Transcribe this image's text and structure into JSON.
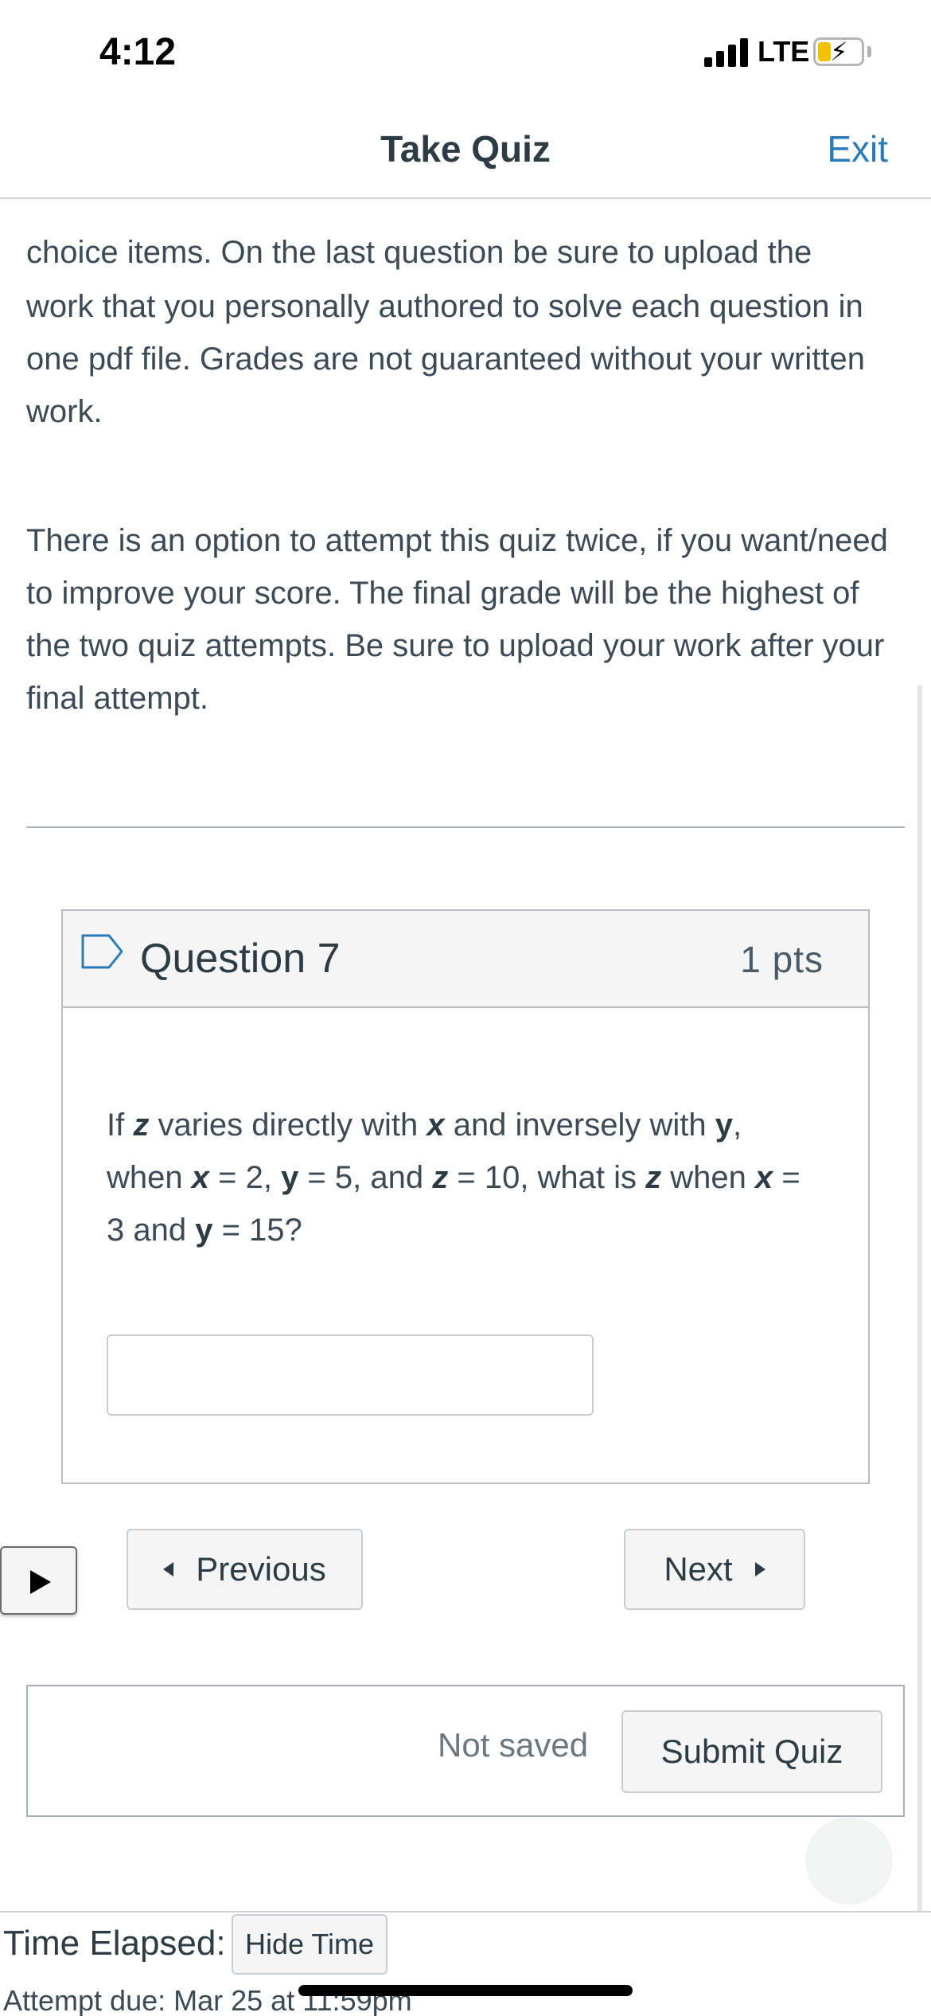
{
  "status_bar": {
    "time": "4:12",
    "network": "LTE",
    "icons": [
      "signal-icon",
      "battery-charging-icon"
    ]
  },
  "nav": {
    "title": "Take Quiz",
    "exit_label": "Exit",
    "exit_color": "#2b7abc"
  },
  "instructions": {
    "partial_line": "choice items.  On the last question be sure to upload the",
    "paragraph_1": "work that you personally authored to solve each question in one pdf file.  Grades are not guaranteed without your written work.",
    "paragraph_2": "There is an option to attempt this quiz twice, if you want/need to improve your score.  The final grade will be the highest of the two quiz attempts.  Be sure to upload your work after your final attempt."
  },
  "question": {
    "title": "Question 7",
    "points": "1 pts",
    "text_parts": [
      "If ",
      "z",
      " varies directly with ",
      "x",
      " and inversely with ",
      "y",
      ",",
      " when ",
      "x",
      " = 2, ",
      "y",
      " = 5, and ",
      "z",
      " = 10, what is ",
      "z",
      " when ",
      "x",
      " = 3 and ",
      "y",
      " = 15?"
    ],
    "answer_value": "",
    "answer_placeholder": ""
  },
  "navigation": {
    "previous_label": "Previous",
    "next_label": "Next"
  },
  "submit": {
    "status": "Not saved",
    "submit_label": "Submit Quiz"
  },
  "footer": {
    "time_elapsed_label": "Time Elapsed:",
    "hide_time_label": "Hide Time",
    "attempt_due": "Attempt due: Mar 25 at 11:59pm"
  }
}
